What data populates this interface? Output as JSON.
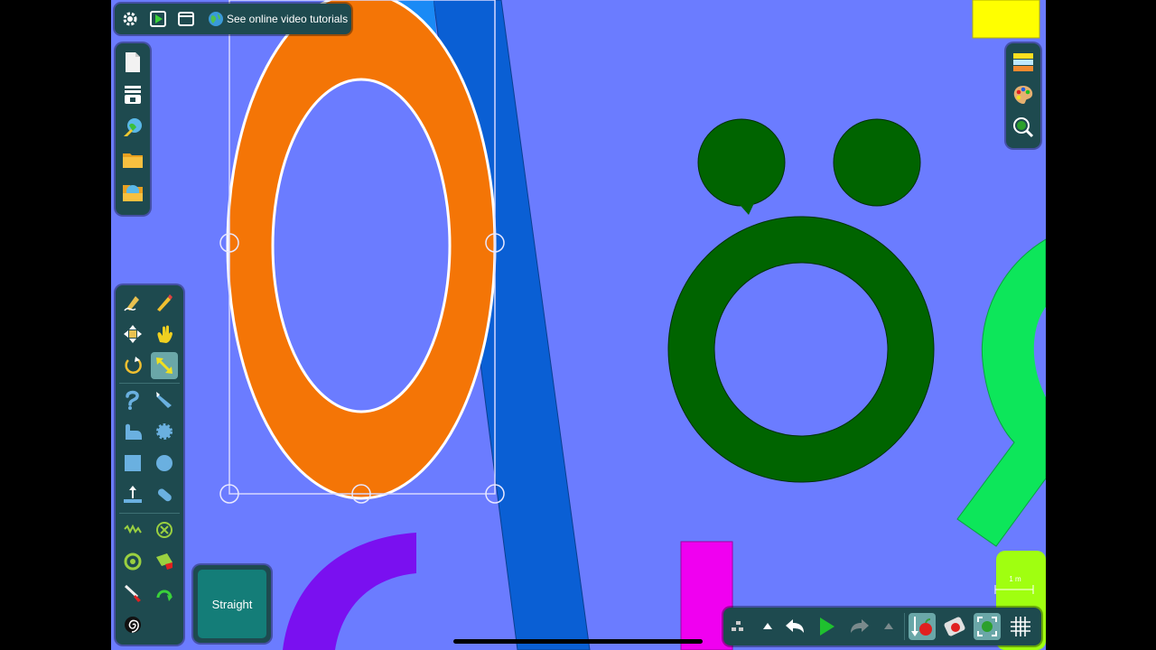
{
  "top_toolbar": {
    "settings_icon": "gear-icon",
    "play_icon": "play-square-icon",
    "window_icon": "window-icon",
    "tutorials_label": "See online video tutorials"
  },
  "straight_button": {
    "label": "Straight"
  },
  "scale": {
    "label": "1 m"
  },
  "colors": {
    "canvas": "#6b7cff",
    "orange_shape": "#f47506",
    "dark_green_shape": "#006400",
    "blue_bar": "#0a5fd4",
    "light_green_shape": "#0de65a",
    "purple_shape": "#7a10f0",
    "magenta_shape": "#f000f0",
    "yellow_shape": "#ffff00",
    "lime_shape": "#a0ff10",
    "panel": "#1e4a4f",
    "active_tool": "#6aa7a8"
  }
}
